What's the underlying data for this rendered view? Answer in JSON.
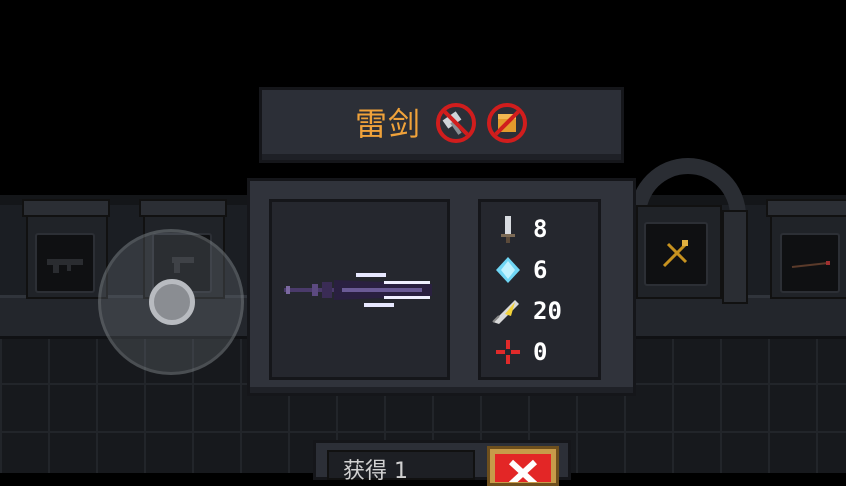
{
  "title": {
    "name": "雷剑",
    "badges": [
      "no-hammer-icon",
      "no-box-icon"
    ]
  },
  "weapon": {
    "icon": "thunder-sword-icon"
  },
  "stats": [
    {
      "icon": "sword-damage-icon",
      "value": "8"
    },
    {
      "icon": "energy-crystal-icon",
      "value": "6"
    },
    {
      "icon": "critical-feather-icon",
      "value": "20"
    },
    {
      "icon": "accuracy-cross-icon",
      "value": "0"
    }
  ],
  "bottom": {
    "label": "获得 1",
    "close_icon": "close-x-icon"
  },
  "colors": {
    "title": "#f0a23a",
    "ban": "#d11d1d",
    "close": "#e32626"
  }
}
